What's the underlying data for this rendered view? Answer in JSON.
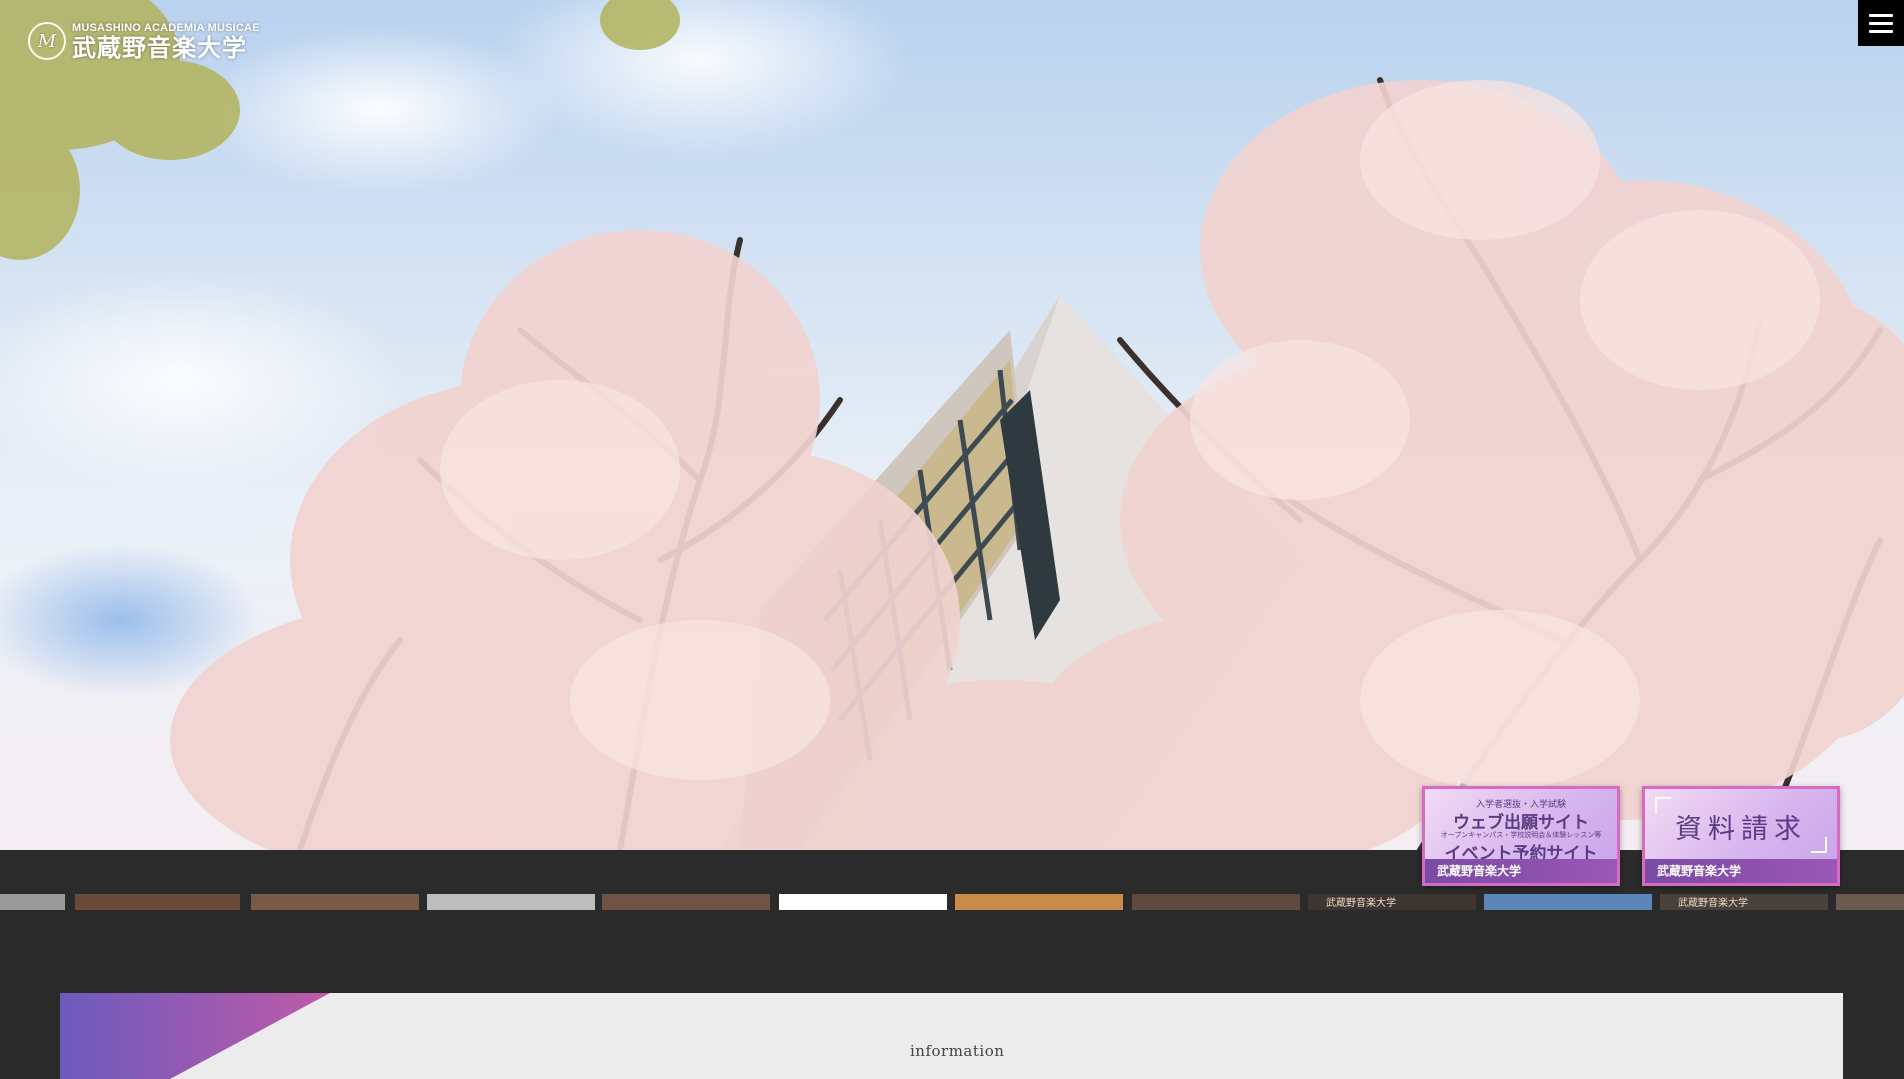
{
  "header": {
    "logo_en": "MUSASHINO ACADEMIA MUSICAE",
    "logo_ja": "武蔵野音楽大学",
    "logo_mark": "M",
    "menu_icon": "hamburger-menu-icon"
  },
  "hero": {
    "image_description_icon": "cherry-blossom-building-photo"
  },
  "banners": [
    {
      "line1": "入学者選抜・入学試験",
      "line2": "ウェブ出願サイト",
      "line3": "オープンキャンパス・学校説明会＆体験レッスン等",
      "line4": "イベント予約サイト",
      "footer": "武蔵野音楽大学"
    },
    {
      "title": "資料請求",
      "footer": "武蔵野音楽大学"
    }
  ],
  "thumbnails": [
    {
      "label": "",
      "color": "#9a9a9a"
    },
    {
      "label": "",
      "color": "#6b4a3a"
    },
    {
      "label": "",
      "color": "#7a5a44"
    },
    {
      "label": "",
      "color": "#bdbdbd"
    },
    {
      "label": "",
      "color": "#6e5346"
    },
    {
      "label": "",
      "color": "#ffffff"
    },
    {
      "label": "",
      "color": "#c98a4a"
    },
    {
      "label": "",
      "color": "#5e4a40"
    },
    {
      "label": "武蔵野音楽大学",
      "color": "#3e3430"
    },
    {
      "label": "",
      "color": "#5a86b8"
    },
    {
      "label": "武蔵野音楽大学",
      "color": "#4a403a"
    },
    {
      "label": "",
      "color": "#6a5a50"
    }
  ],
  "info": {
    "heading": "information"
  },
  "colors": {
    "accent_purple": "#7b5cc0",
    "accent_pink": "#d66bc2",
    "dark_bg": "#2a2a2a",
    "panel_bg": "#ececec"
  }
}
